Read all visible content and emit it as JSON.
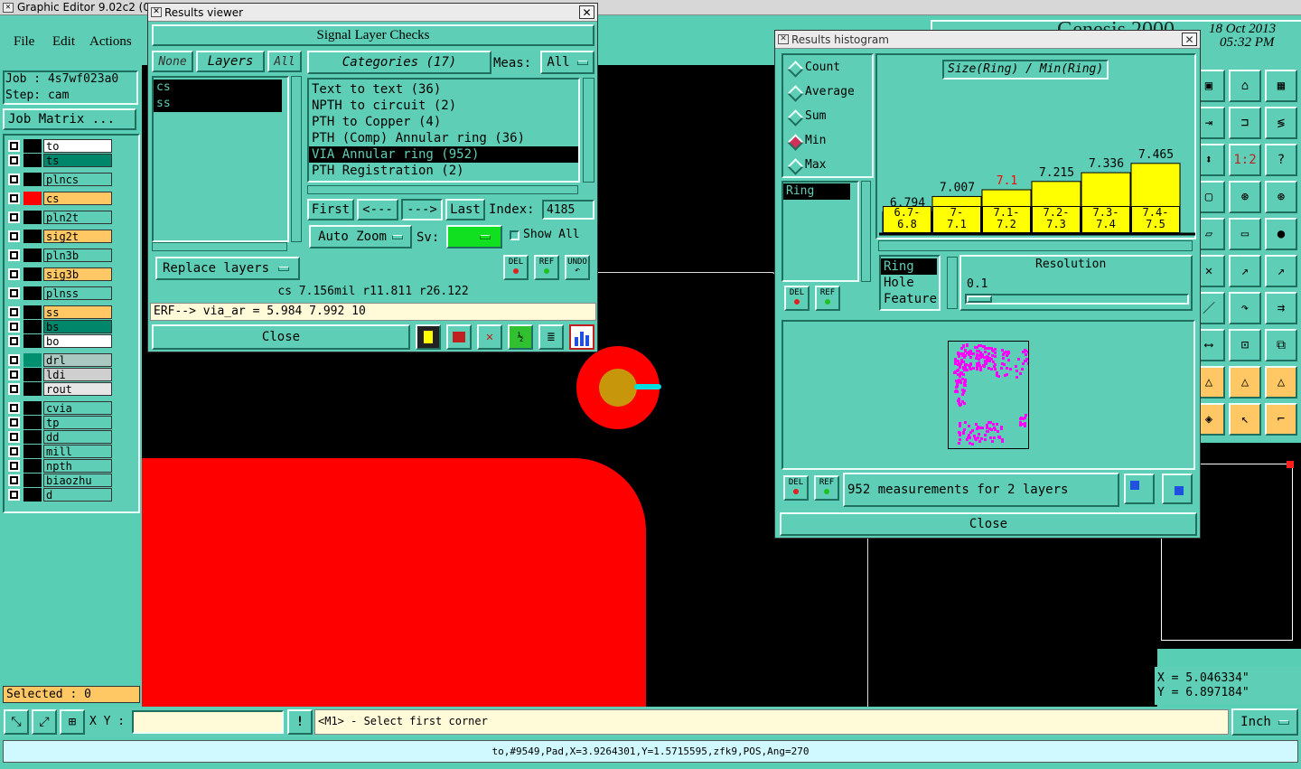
{
  "app": {
    "title": "Graphic Editor 9.02c2 (00",
    "menu": [
      "File",
      "Edit",
      "Actions"
    ],
    "date": "18 Oct 2013",
    "time": "05:32 PM",
    "clock_partial": "Genesis 2000"
  },
  "job": {
    "job_label": "Job : 4s7wf023a0",
    "step_label": "Step: cam",
    "matrix_btn": "Job Matrix ..."
  },
  "layers": [
    {
      "name": "to",
      "bg": "#ffffff",
      "color": "#000000"
    },
    {
      "name": "ts",
      "bg": "#00866b",
      "color": "#000000"
    },
    {
      "name": "plncs",
      "bg": "#5ecfb6",
      "color": "#000000"
    },
    {
      "name": "cs",
      "bg": "#ffc864",
      "color": "#ff0000"
    },
    {
      "name": "pln2t",
      "bg": "#5ecfb6",
      "color": "#000000"
    },
    {
      "name": "sig2t",
      "bg": "#ffc864",
      "color": "#000000"
    },
    {
      "name": "pln3b",
      "bg": "#5ecfb6",
      "color": "#000000"
    },
    {
      "name": "sig3b",
      "bg": "#ffc864",
      "color": "#000000"
    },
    {
      "name": "plnss",
      "bg": "#5ecfb6",
      "color": "#000000"
    },
    {
      "name": "ss",
      "bg": "#ffc864",
      "color": "#000000"
    },
    {
      "name": "bs",
      "bg": "#00866b",
      "color": "#000000"
    },
    {
      "name": "bo",
      "bg": "#ffffff",
      "color": "#000000"
    },
    {
      "name": "drl",
      "bg": "#a8c8c0",
      "color": "#009070"
    },
    {
      "name": "ldi",
      "bg": "#cfcfcf",
      "color": "#000000"
    },
    {
      "name": "rout",
      "bg": "#e6e6e6",
      "color": "#000000"
    },
    {
      "name": "cvia",
      "bg": "#5ecfb6",
      "color": "#000000"
    },
    {
      "name": "tp",
      "bg": "#5ecfb6",
      "color": "#000000"
    },
    {
      "name": "dd",
      "bg": "#5ecfb6",
      "color": "#000000"
    },
    {
      "name": "mill",
      "bg": "#5ecfb6",
      "color": "#000000"
    },
    {
      "name": "npth",
      "bg": "#5ecfb6",
      "color": "#000000"
    },
    {
      "name": "biaozhu",
      "bg": "#5ecfb6",
      "color": "#000000"
    },
    {
      "name": "d",
      "bg": "#5ecfb6",
      "color": "#000000"
    }
  ],
  "selected": "Selected : 0",
  "results_viewer": {
    "title": "Results viewer",
    "header": "Signal Layer Checks",
    "btn_none": "None",
    "btn_layers": "Layers",
    "btn_all": "All",
    "layer_list": [
      "cs",
      "ss"
    ],
    "categories_btn": "Categories (17)",
    "meas_label": "Meas:",
    "meas_value": "All",
    "categories": [
      "Text to text (36)",
      "NPTH to circuit (2)",
      "PTH to Copper (4)",
      "PTH (Comp) Annular ring (36)",
      "VIA Annular ring (952)",
      "PTH Registration (2)"
    ],
    "nav": {
      "first": "First",
      "prev": "<---",
      "next": "--->",
      "last": "Last",
      "index_label": "Index:",
      "index_value": "4185"
    },
    "auto_zoom": "Auto Zoom",
    "sv_label": "Sv:",
    "show_all": "Show All",
    "replace_layers": "Replace layers",
    "icons": {
      "del": "DEL",
      "ref": "REF",
      "undo": "UNDO"
    },
    "info_line": "cs 7.156mil  r11.811  r26.122",
    "erf_line": "ERF--> via_ar = 5.984 7.992 10",
    "close": "Close"
  },
  "histogram": {
    "title": "Results histogram",
    "modes": [
      "Count",
      "Average",
      "Sum",
      "Min",
      "Max"
    ],
    "selected_mode": "Min",
    "formula": "Size(Ring) / Min(Ring)",
    "meas_list": [
      "Ring"
    ],
    "field_list": [
      "Ring",
      "Hole",
      "Feature"
    ],
    "resolution_label": "Resolution",
    "resolution_value": "0.1",
    "summary": "952 measurements for 2 layers",
    "close": "Close",
    "icons": {
      "del": "DEL",
      "ref": "REF"
    }
  },
  "chart_data": {
    "type": "bar",
    "categories": [
      "6.7-6.8",
      "7-7.1",
      "7.1-7.2",
      "7.2-7.3",
      "7.3-7.4",
      "7.4-7.5"
    ],
    "values": [
      6.794,
      7.007,
      7.1,
      7.215,
      7.336,
      7.465
    ],
    "value_labels": [
      "6.794",
      "7.007",
      "7.1",
      "7.215",
      "7.336",
      "7.465"
    ],
    "category_labels": [
      [
        "6.7-",
        "6.8"
      ],
      [
        "7-",
        "7.1"
      ],
      [
        "7.1-",
        "7.2"
      ],
      [
        "7.2-",
        "7.3"
      ],
      [
        "7.3-",
        "7.4"
      ],
      [
        "7.4-",
        "7.5"
      ]
    ],
    "highlight_index": 2,
    "bar_color": "#ffff00",
    "highlight_label_color": "#ff0000"
  },
  "coords": {
    "x": "X = 5.046334\"",
    "y": "Y = 6.897184\""
  },
  "bottom": {
    "xy_label": "X Y :",
    "xy_value": "",
    "prompt": "<M1> - Select first corner",
    "units": "Inch",
    "status": "to,#9549,Pad,X=3.9264301,Y=1.5715595,zfk9,POS,Ang=270"
  },
  "colors": {
    "bg": "#58cfb5",
    "canvas": "#000000",
    "copper": "#ff0000",
    "pad": "#c8960a",
    "ring_line": "#00e0e0",
    "dots": "#ff00ff"
  }
}
